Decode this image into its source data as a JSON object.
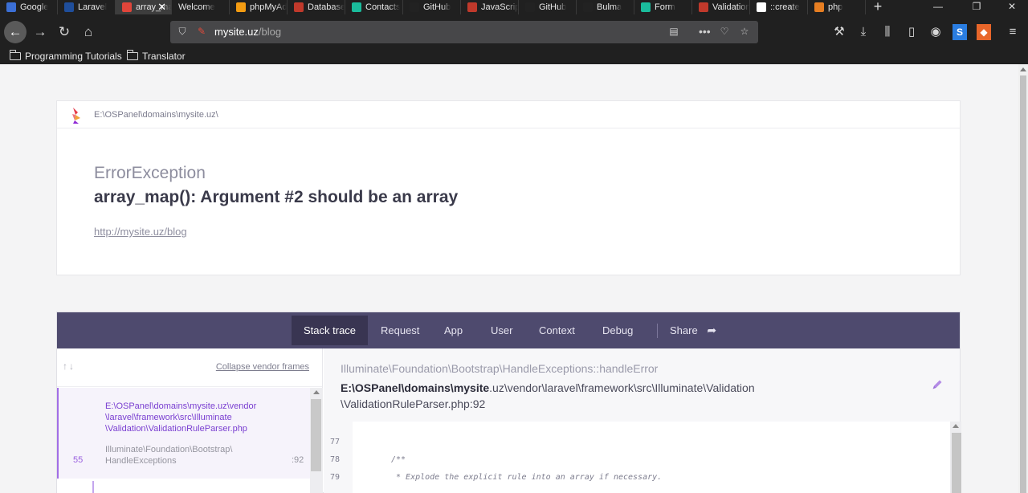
{
  "browser": {
    "tabs": [
      {
        "title": "Google",
        "color": "#3b6fd6",
        "active": false
      },
      {
        "title": "Laravel",
        "color": "#1f4e9b",
        "active": false
      },
      {
        "title": "array_map",
        "color": "#e0453a",
        "active": true
      },
      {
        "title": "Welcome",
        "color": "",
        "active": false
      },
      {
        "title": "phpMyAdmin",
        "color": "#f39c12",
        "active": false
      },
      {
        "title": "Database",
        "color": "#c0392b",
        "active": false
      },
      {
        "title": "Contacts",
        "color": "#1abc9c",
        "active": false
      },
      {
        "title": "GitHub",
        "color": "#222222",
        "active": false
      },
      {
        "title": "JavaScript",
        "color": "#c0392b",
        "active": false
      },
      {
        "title": "GitHub",
        "color": "#222222",
        "active": false
      },
      {
        "title": "Bulma",
        "color": "#222222",
        "active": false
      },
      {
        "title": "Form",
        "color": "#1abc9c",
        "active": false
      },
      {
        "title": "Validation",
        "color": "#c0392b",
        "active": false
      },
      {
        "title": "::create",
        "color": "#ffffff",
        "active": false
      },
      {
        "title": "php",
        "color": "#e67e22",
        "active": false
      }
    ],
    "new_tab_label": "+",
    "window_controls": {
      "minimize": "—",
      "restore": "❐",
      "close": "✕"
    },
    "url": {
      "host": "mysite.uz",
      "path": "/blog"
    },
    "bookmarks": [
      "Programming Tutorials",
      "Translator"
    ]
  },
  "error": {
    "path": "E:\\OSPanel\\domains\\mysite.uz\\",
    "exception_class": "ErrorException",
    "message": "array_map(): Argument #2 should be an array",
    "url": "http://mysite.uz/blog"
  },
  "tabs_nav": [
    "Stack trace",
    "Request",
    "App",
    "User",
    "Context",
    "Debug"
  ],
  "share_label": "Share",
  "frames": {
    "collapse_label": "Collapse vendor frames",
    "selected": {
      "number": "55",
      "file": "E:\\OSPanel\\domains\\mysite.uz\\vendor\\laravel\\framework\\src\\Illuminate\\Validation\\ValidationRuleParser.php",
      "file_lines": [
        "E:\\OSPanel\\domains\\mysite.uz\\vendor",
        "\\laravel\\framework\\src\\Illuminate",
        "\\Validation\\ValidationRuleParser.php"
      ],
      "class_lines": [
        "Illuminate\\Foundation\\Bootstrap\\",
        "HandleExceptions"
      ],
      "line": ":92"
    }
  },
  "detail": {
    "class": "Illuminate\\Foundation\\Bootstrap\\HandleExceptions::handleError",
    "file_bold": "E:\\OSPanel\\domains\\mysite",
    "file_rest": ".uz\\vendor\\laravel\\framework\\src\\Illuminate\\Validation",
    "file_line2": "\\ValidationRuleParser.php:92",
    "code_lines": [
      {
        "n": "77",
        "text": ""
      },
      {
        "n": "78",
        "text": "/**"
      },
      {
        "n": "79",
        "text": " * Explode the explicit rule into an array if necessary."
      }
    ]
  },
  "colors": {
    "nav_bg": "#4e4a6e",
    "accent": "#a26ee6"
  }
}
